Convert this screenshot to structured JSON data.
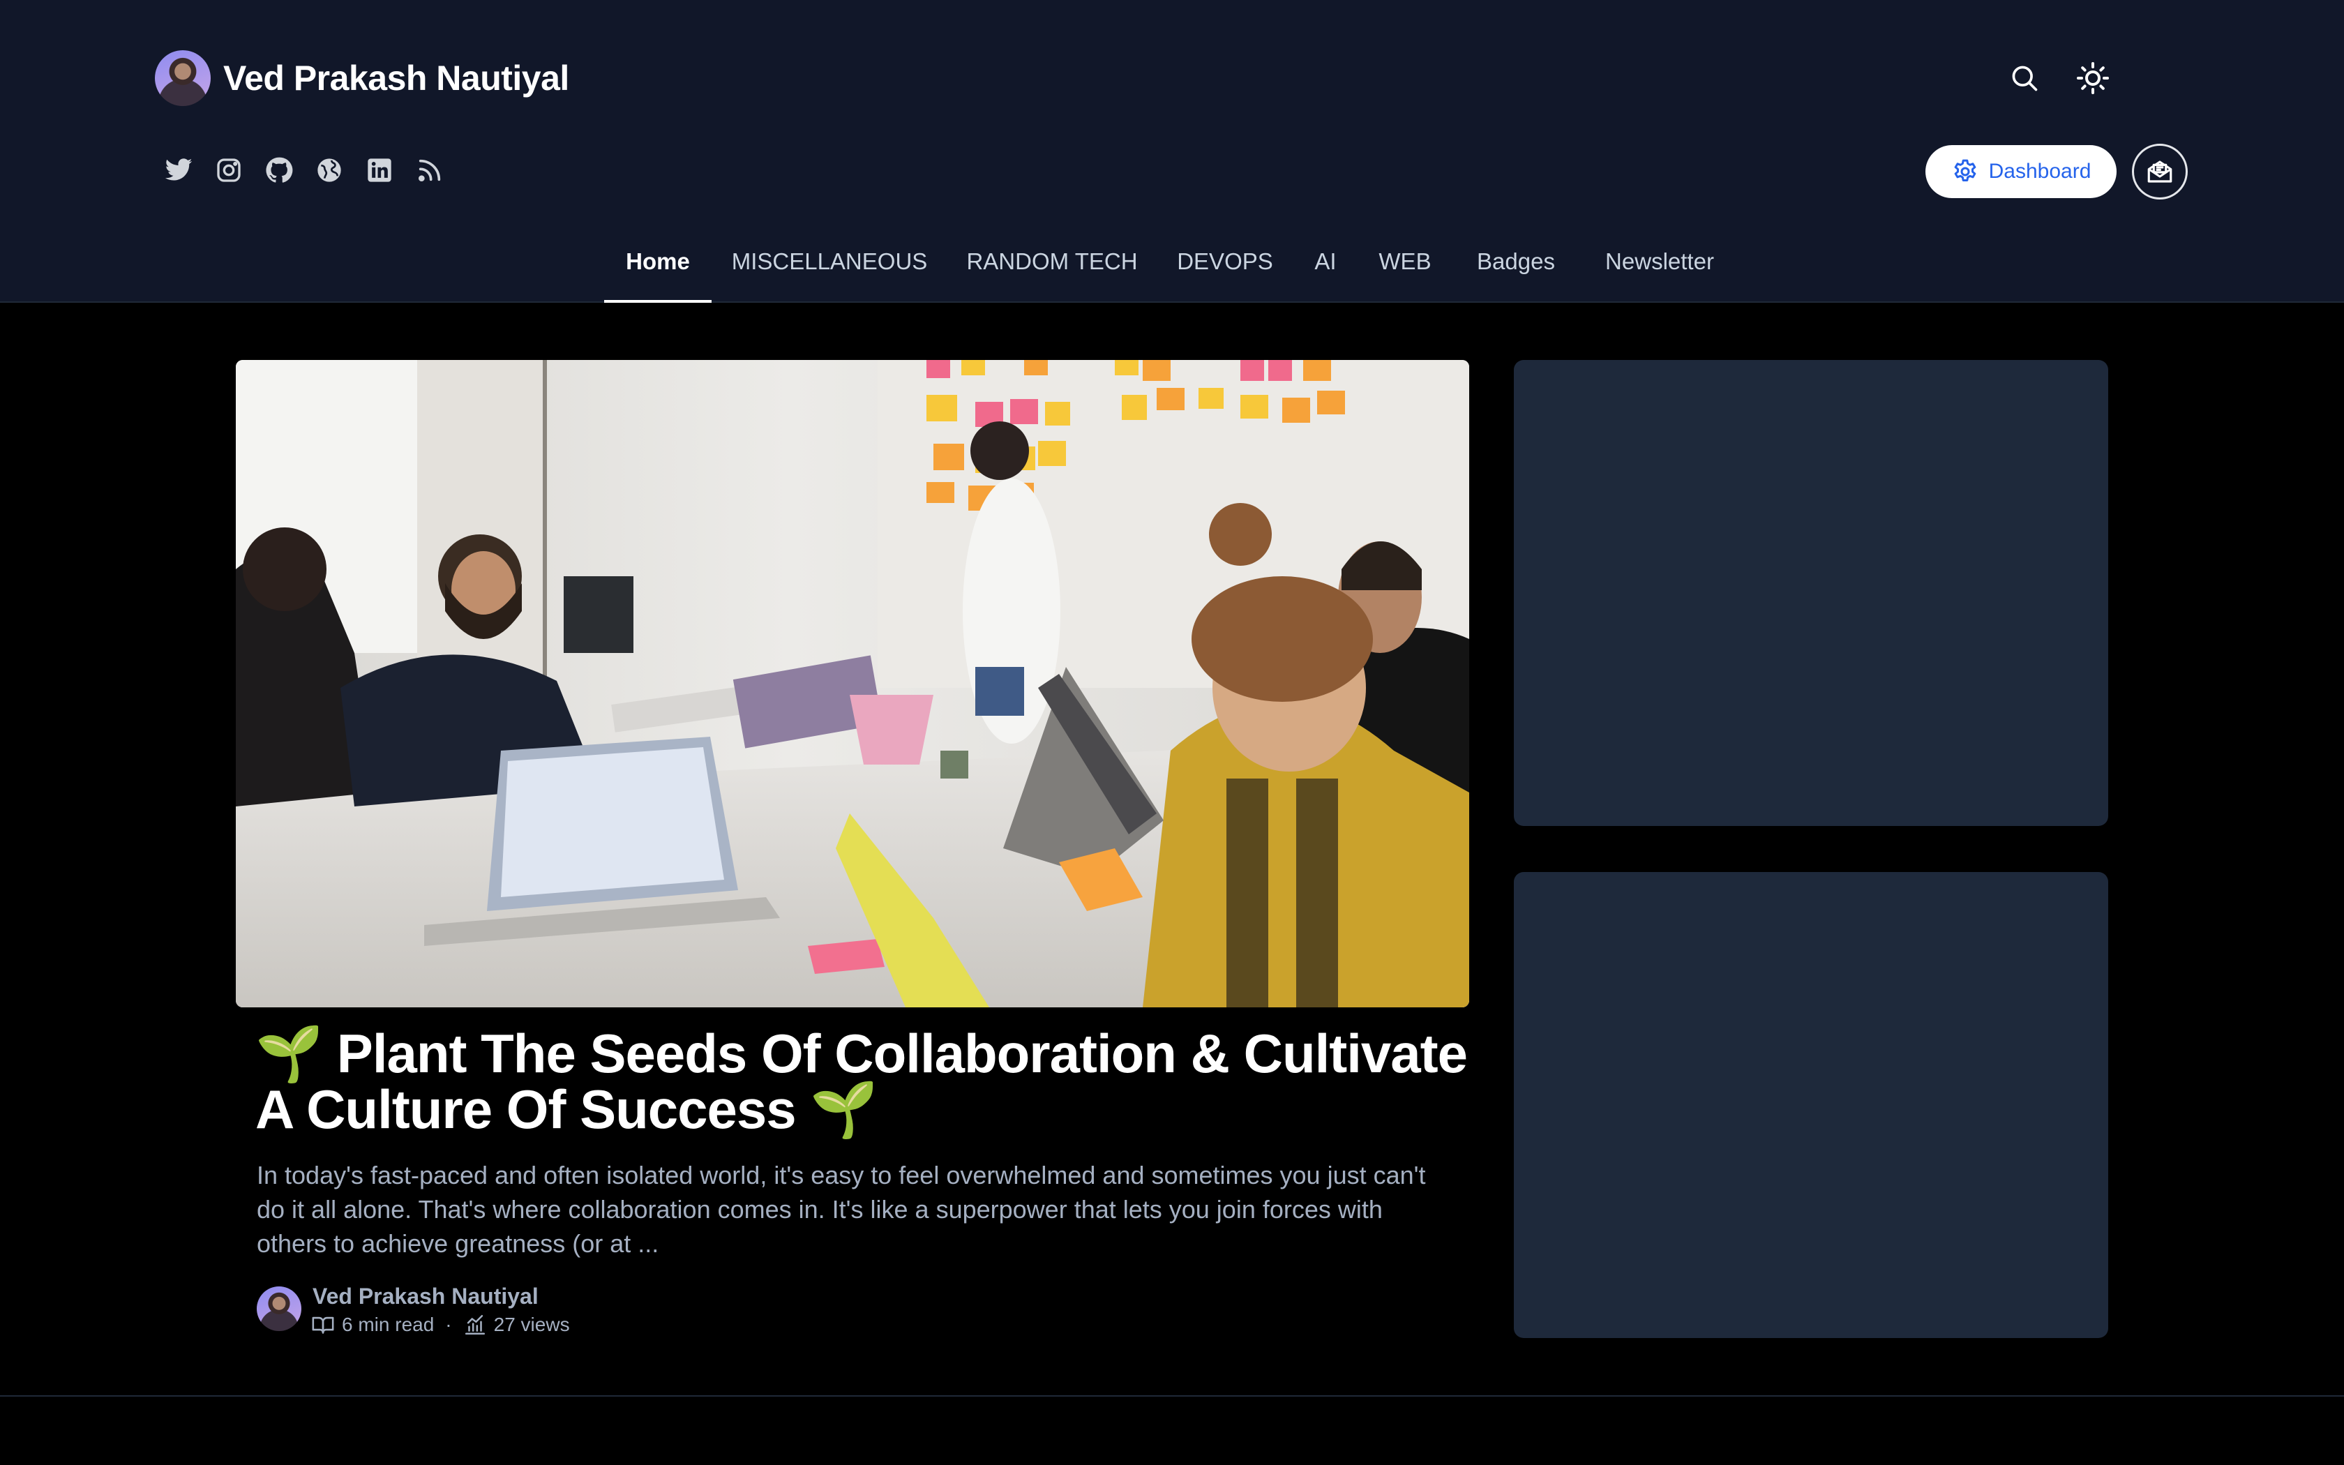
{
  "site": {
    "author_name": "Ved Prakash Nautiyal"
  },
  "header": {
    "icons": [
      "search-icon",
      "sun-icon"
    ],
    "social_icons": [
      "twitter-icon",
      "instagram-icon",
      "github-icon",
      "globe-icon",
      "linkedin-icon",
      "rss-icon"
    ],
    "dashboard_label": "Dashboard",
    "newsletter_icon": "mail-open-icon"
  },
  "nav": {
    "items": [
      {
        "label": "Home",
        "active": true
      },
      {
        "label": "MISCELLANEOUS",
        "active": false
      },
      {
        "label": "RANDOM TECH",
        "active": false
      },
      {
        "label": "DEVOPS",
        "active": false
      },
      {
        "label": "AI",
        "active": false
      },
      {
        "label": "WEB",
        "active": false
      },
      {
        "label": "Badges",
        "active": false
      },
      {
        "label": "Newsletter",
        "active": false
      }
    ]
  },
  "featured_post": {
    "title": "🌱 Plant The Seeds Of Collaboration & Cultivate A Culture Of Success 🌱",
    "excerpt": "In today's fast-paced and often isolated world, it's easy to feel overwhelmed and sometimes you just can't do it all alone. That's where collaboration comes in. It's like a superpower that lets you join forces with others to achieve greatness (or at ...",
    "author": "Ved Prakash Nautiyal",
    "read_time": "6 min read",
    "separator": "·",
    "views": "27 views"
  },
  "colors": {
    "header_bg": "#111729",
    "page_bg": "#000000",
    "card_bg": "#1e293b",
    "accent": "#2563eb",
    "muted_text": "#a5b0c2"
  }
}
